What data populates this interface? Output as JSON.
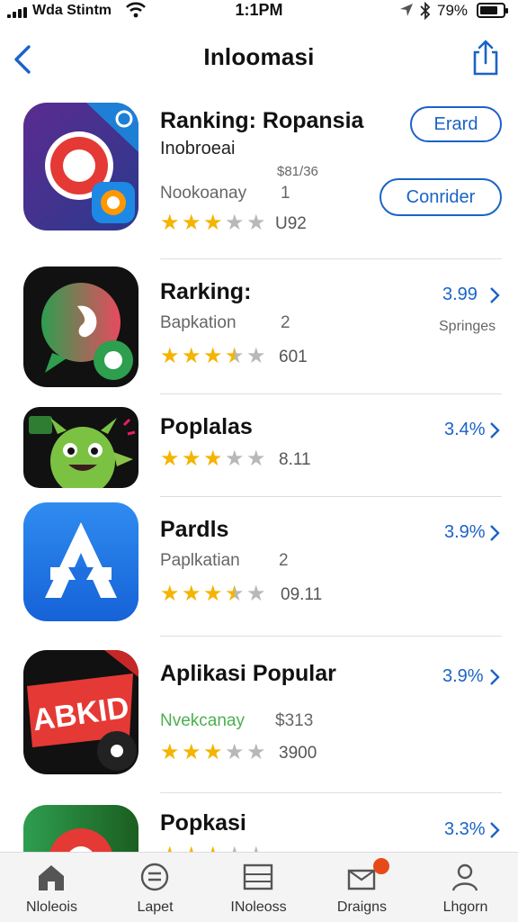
{
  "status_bar": {
    "carrier": "Wda Stintm",
    "time": "1:1PM",
    "battery_pct": "79%",
    "icons": [
      "signal-icon",
      "wifi-icon",
      "location-icon",
      "bluetooth-icon",
      "battery-icon"
    ]
  },
  "nav": {
    "title": "Inloomasi",
    "back_icon": "chevron-left-icon",
    "share_icon": "share-icon"
  },
  "apps": [
    {
      "name": "Ranking: Ropansia",
      "subtitle": "Inobroeai",
      "price_note": "$81/36",
      "category": "Nookoanay",
      "count": "1",
      "rating": 3,
      "rating_text": "U92",
      "button1": "Erard",
      "button2": "Conrider"
    },
    {
      "name": "Rarking:",
      "category": "Bapkation",
      "count": "2",
      "rating": 3.5,
      "rating_text": "601",
      "price": "3.99",
      "note": "Springes"
    },
    {
      "name": "Poplalas",
      "rating": 3,
      "rating_text": "8.11",
      "price": "3.4%"
    },
    {
      "name": "Pardls",
      "category": "Paplkatian",
      "count": "2",
      "rating": 3.5,
      "rating_text": "09.11",
      "price": "3.9%"
    },
    {
      "name": "Aplikasi Popular",
      "category": "Nvekcanay",
      "count": "$313",
      "rating": 3,
      "rating_text": "3900",
      "price": "3.9%",
      "icon_text": "ABKID"
    },
    {
      "name": "Popkasi",
      "price": "3.3%"
    }
  ],
  "tabs": [
    {
      "label": "Nloleois",
      "icon": "home-icon"
    },
    {
      "label": "Lapet",
      "icon": "list-icon"
    },
    {
      "label": "INoleoss",
      "icon": "grid-icon"
    },
    {
      "label": "Draigns",
      "icon": "inbox-icon",
      "badge": true
    },
    {
      "label": "Lhgorn",
      "icon": "person-icon"
    }
  ],
  "colors": {
    "accent": "#1a63c7",
    "star": "#f4b400",
    "star_empty": "#b8b8b8",
    "badge": "#e64a19",
    "tabbar_bg": "#f4f4f4"
  }
}
